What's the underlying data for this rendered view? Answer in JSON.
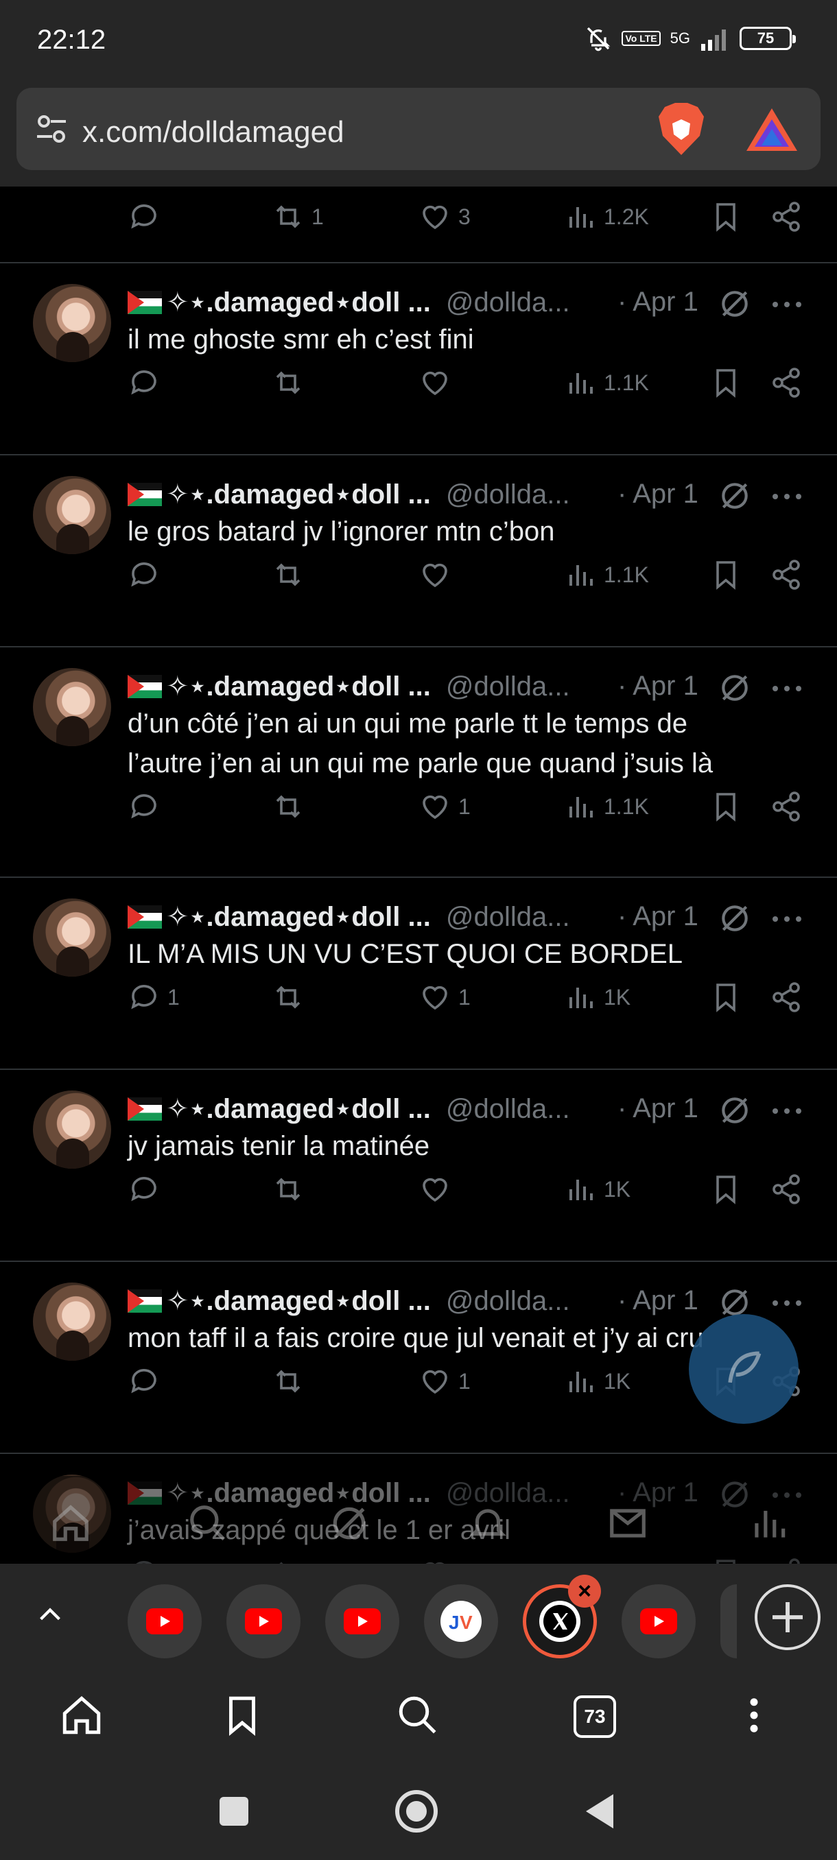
{
  "status_bar": {
    "time": "22:12",
    "network": "5G",
    "volte": "Vo LTE",
    "battery": "75"
  },
  "browser": {
    "url": "x.com/dolldamaged",
    "tabs_count": "73"
  },
  "top_partial_actions": {
    "replies": "",
    "retweets": "1",
    "likes": "3",
    "views": "1.2K"
  },
  "tweets": [
    {
      "name": "✧⋆.damaged⋆doll ...",
      "handle": "@dollda...",
      "date": "· Apr 1",
      "text": [
        "il me ghoste smr eh c’est fini"
      ],
      "replies": "",
      "retweets": "",
      "likes": "",
      "views": "1.1K"
    },
    {
      "name": "✧⋆.damaged⋆doll ...",
      "handle": "@dollda...",
      "date": "· Apr 1",
      "text": [
        "le gros batard jv l’ignorer mtn c’bon"
      ],
      "replies": "",
      "retweets": "",
      "likes": "",
      "views": "1.1K"
    },
    {
      "name": "✧⋆.damaged⋆doll ...",
      "handle": "@dollda...",
      "date": "· Apr 1",
      "text": [
        "d’un côté j’en ai un qui me parle tt le temps de",
        "l’autre j’en ai un qui me parle que quand j’suis là"
      ],
      "replies": "",
      "retweets": "",
      "likes": "1",
      "views": "1.1K"
    },
    {
      "name": "✧⋆.damaged⋆doll ...",
      "handle": "@dollda...",
      "date": "· Apr 1",
      "text": [
        "IL M’A MIS UN VU C’EST QUOI CE BORDEL"
      ],
      "replies": "1",
      "retweets": "",
      "likes": "1",
      "views": "1K"
    },
    {
      "name": "✧⋆.damaged⋆doll ...",
      "handle": "@dollda...",
      "date": "· Apr 1",
      "text": [
        "jv jamais tenir la matinée"
      ],
      "replies": "",
      "retweets": "",
      "likes": "",
      "views": "1K"
    },
    {
      "name": "✧⋆.damaged⋆doll ...",
      "handle": "@dollda...",
      "date": "· Apr 1",
      "text": [
        "mon taff il a fais croire que jul venait et j’y ai cru"
      ],
      "replies": "",
      "retweets": "",
      "likes": "1",
      "views": "1K"
    },
    {
      "name": "✧⋆.damaged⋆doll ...",
      "handle": "@dollda...",
      "date": "· Apr 1",
      "text": [
        "j’avais zappé que ct le 1 er avril"
      ],
      "replies": "",
      "retweets": "",
      "likes": "",
      "views": ""
    }
  ],
  "colors": {
    "accent": "#1d9bf0",
    "muted": "#71767b",
    "brave": "#f05a3c"
  }
}
